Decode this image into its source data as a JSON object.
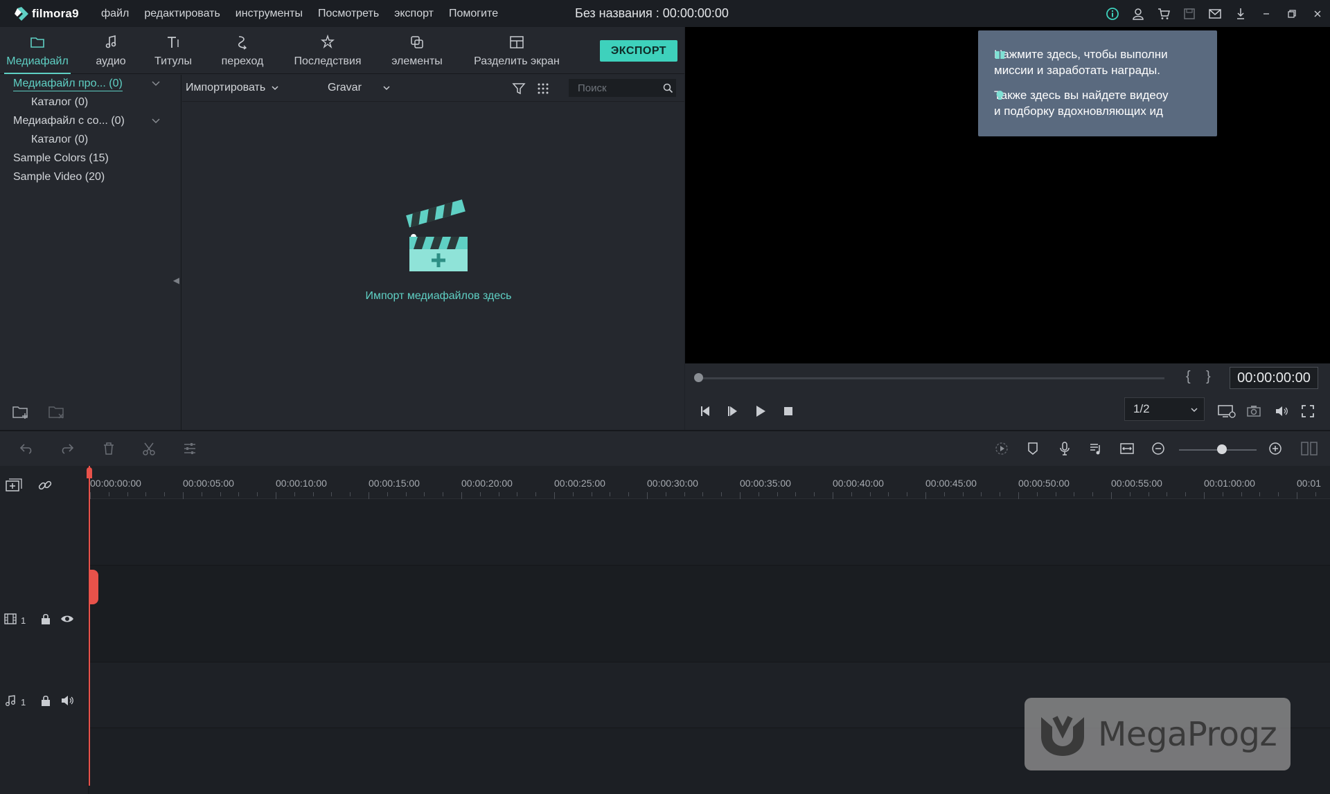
{
  "app": {
    "logo_text": "filmora9",
    "doc_title": "Без названия : 00:00:00:00"
  },
  "menu": [
    "файл",
    "редактировать",
    "инструменты",
    "Посмотреть",
    "экспорт",
    "Помогите"
  ],
  "title_icons": [
    "info-icon",
    "account-icon",
    "cart-icon",
    "save-icon",
    "mail-icon",
    "download-icon",
    "minimize-icon",
    "restore-icon",
    "close-icon"
  ],
  "media_tabs": [
    {
      "label": "Медиафайл",
      "icon": "folder-icon",
      "active": true
    },
    {
      "label": "аудио",
      "icon": "music-note-icon"
    },
    {
      "label": "Титулы",
      "icon": "title-icon"
    },
    {
      "label": "переход",
      "icon": "transition-icon"
    },
    {
      "label": "Последствия",
      "icon": "effects-icon"
    },
    {
      "label": "элементы",
      "icon": "elements-icon"
    },
    {
      "label": "Разделить экран",
      "icon": "split-screen-icon"
    }
  ],
  "export_label": "ЭКСПОРТ",
  "library": [
    {
      "label": "Медиафайл про... (0)",
      "active": true,
      "expandable": true
    },
    {
      "label": "Каталог (0)"
    },
    {
      "label": "Медиафайл с со... (0)",
      "expandable": true
    },
    {
      "label": "Каталог (0)"
    },
    {
      "label": "Sample Colors (15)"
    },
    {
      "label": "Sample Video (20)"
    }
  ],
  "media_toolbar": {
    "import_label": "Импортировать",
    "sort_label": "Gravar",
    "search_placeholder": "Поиск"
  },
  "import_zone_text": "Импорт медиафайлов здесь",
  "tooltip": {
    "line1a": "Нажмите здесь, чтобы выполни",
    "line1b": "миссии и заработать награды.",
    "line2a": "Также здесь вы найдете видеоу",
    "line2b": "и подборку вдохновляющих ид"
  },
  "preview": {
    "timecode": "00:00:00:00",
    "quality": "1/2",
    "progress": 0
  },
  "timeline": {
    "ruler_labels": [
      "00:00:00:00",
      "00:00:05:00",
      "00:00:10:00",
      "00:00:15:00",
      "00:00:20:00",
      "00:00:25:00",
      "00:00:30:00",
      "00:00:35:00",
      "00:00:40:00",
      "00:00:45:00",
      "00:00:50:00",
      "00:00:55:00",
      "00:01:00:00",
      "00:01"
    ],
    "video_track_number": "1",
    "audio_track_number": "1",
    "zoom_level": 0.55
  },
  "watermark_text": "MegaProgz",
  "colors": {
    "accent": "#3ed1bc",
    "accent_text": "#5fd0c4",
    "playhead": "#e8524a",
    "tooltip_bg": "#5a6a7f"
  }
}
